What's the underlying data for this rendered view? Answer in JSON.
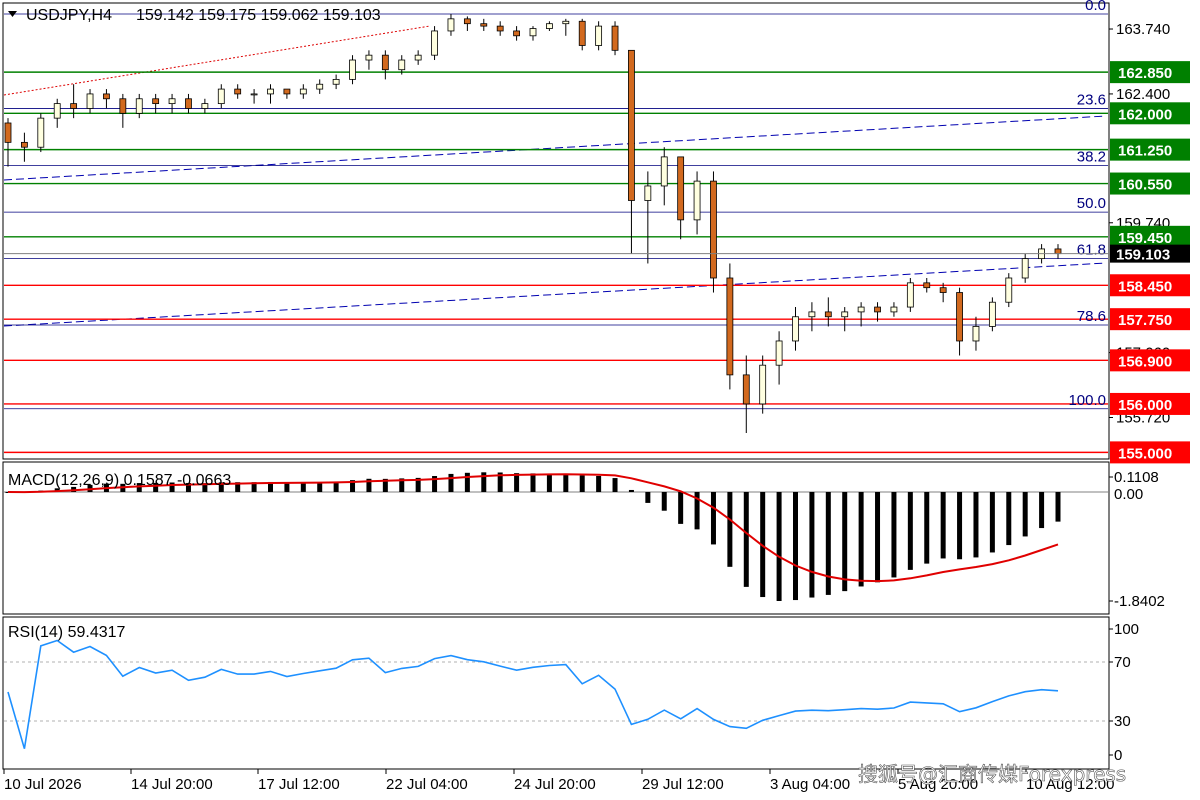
{
  "header": {
    "symbol": "USDJPY,H4",
    "ohlc": "159.142 159.175 159.062 159.103"
  },
  "price_axis": [
    {
      "text": "163.740",
      "v": 163.74
    },
    {
      "text": "162.400",
      "v": 162.4
    },
    {
      "text": "159.740",
      "v": 159.74
    },
    {
      "text": "157.060",
      "v": 157.06
    },
    {
      "text": "155.720",
      "v": 155.72
    }
  ],
  "current_price": {
    "text": "159.103",
    "v": 159.103
  },
  "levels": [
    {
      "text": "162.850",
      "v": 162.85,
      "color": "#008000"
    },
    {
      "text": "162.000",
      "v": 162.0,
      "color": "#008000"
    },
    {
      "text": "161.250",
      "v": 161.25,
      "color": "#008000"
    },
    {
      "text": "160.550",
      "v": 160.55,
      "color": "#008000"
    },
    {
      "text": "159.450",
      "v": 159.45,
      "color": "#008000"
    },
    {
      "text": "158.450",
      "v": 158.45,
      "color": "#ff0000"
    },
    {
      "text": "157.750",
      "v": 157.75,
      "color": "#ff0000"
    },
    {
      "text": "156.900",
      "v": 156.9,
      "color": "#ff0000"
    },
    {
      "text": "156.000",
      "v": 156.0,
      "color": "#ff0000"
    },
    {
      "text": "155.000",
      "v": 155.0,
      "color": "#ff0000"
    }
  ],
  "fib_levels": [
    {
      "text": "0.0",
      "v": 164.05
    },
    {
      "text": "23.6",
      "v": 162.1
    },
    {
      "text": "38.2",
      "v": 160.92
    },
    {
      "text": "50.0",
      "v": 159.96
    },
    {
      "text": "61.8",
      "v": 159.0
    },
    {
      "text": "78.6",
      "v": 157.63
    },
    {
      "text": "100.0",
      "v": 155.9
    }
  ],
  "macd": {
    "label": "MACD(12,26,9) 0.1587 -0.0663",
    "max_text": "0.1108",
    "zero_text": "0.00",
    "min_text": "-1.8402",
    "max": 0.1108,
    "min": -1.8402
  },
  "rsi": {
    "label": "RSI(14) 59.4317",
    "ticks": [
      "100",
      "70",
      "30",
      "0"
    ]
  },
  "time_axis": [
    "10 Jul 2026",
    "14 Jul 20:00",
    "17 Jul 12:00",
    "22 Jul 04:00",
    "24 Jul 20:00",
    "29 Jul 12:00",
    "3 Aug 04:00",
    "5 Aug 20:00",
    "10 Aug 12:00"
  ],
  "watermark": "搜狐号@汇商传媒Forexpress",
  "colors": {
    "bull": "#ffffe0",
    "bear": "#d2691e",
    "level_green": "#008000",
    "level_red": "#ff0000",
    "fib": "#00007f",
    "rsi": "#1e90ff",
    "signal": "#e00000"
  },
  "chart_data": {
    "type": "candlestick",
    "title": "USDJPY,H4",
    "timeframe": "H4",
    "ylim": [
      155.0,
      164.2
    ],
    "candles_note_first_to_last": [
      [
        161.8,
        161.9,
        160.9,
        161.4
      ],
      [
        161.4,
        161.6,
        161.0,
        161.3
      ],
      [
        161.3,
        162.0,
        161.2,
        161.9
      ],
      [
        161.9,
        162.3,
        161.7,
        162.2
      ],
      [
        162.2,
        162.6,
        161.9,
        162.1
      ],
      [
        162.1,
        162.5,
        162.0,
        162.4
      ],
      [
        162.4,
        162.5,
        162.1,
        162.3
      ],
      [
        162.3,
        162.4,
        161.7,
        162.0
      ],
      [
        162.0,
        162.4,
        161.9,
        162.3
      ],
      [
        162.3,
        162.4,
        162.0,
        162.2
      ],
      [
        162.2,
        162.4,
        162.0,
        162.3
      ],
      [
        162.3,
        162.4,
        162.0,
        162.1
      ],
      [
        162.1,
        162.3,
        162.0,
        162.2
      ],
      [
        162.2,
        162.6,
        162.1,
        162.5
      ],
      [
        162.5,
        162.6,
        162.3,
        162.4
      ],
      [
        162.4,
        162.5,
        162.2,
        162.4
      ],
      [
        162.4,
        162.6,
        162.2,
        162.5
      ],
      [
        162.5,
        162.5,
        162.3,
        162.4
      ],
      [
        162.4,
        162.6,
        162.3,
        162.5
      ],
      [
        162.5,
        162.7,
        162.4,
        162.6
      ],
      [
        162.6,
        162.8,
        162.5,
        162.7
      ],
      [
        162.7,
        163.2,
        162.6,
        163.1
      ],
      [
        163.1,
        163.3,
        162.9,
        163.2
      ],
      [
        163.2,
        163.3,
        162.7,
        162.9
      ],
      [
        162.9,
        163.2,
        162.8,
        163.1
      ],
      [
        163.1,
        163.3,
        163.0,
        163.2
      ],
      [
        163.2,
        163.8,
        163.1,
        163.7
      ],
      [
        163.7,
        164.05,
        163.6,
        163.95
      ],
      [
        163.95,
        164.0,
        163.7,
        163.85
      ],
      [
        163.85,
        163.95,
        163.7,
        163.8
      ],
      [
        163.8,
        163.9,
        163.6,
        163.7
      ],
      [
        163.7,
        163.8,
        163.5,
        163.6
      ],
      [
        163.6,
        163.8,
        163.5,
        163.75
      ],
      [
        163.75,
        163.9,
        163.7,
        163.85
      ],
      [
        163.85,
        163.95,
        163.6,
        163.9
      ],
      [
        163.9,
        163.95,
        163.3,
        163.4
      ],
      [
        163.4,
        163.9,
        163.3,
        163.8
      ],
      [
        163.8,
        163.9,
        163.2,
        163.3
      ],
      [
        163.3,
        162.6,
        159.1,
        160.2
      ],
      [
        160.2,
        160.8,
        158.9,
        160.5
      ],
      [
        160.5,
        161.3,
        160.1,
        161.1
      ],
      [
        161.1,
        160.9,
        159.4,
        159.8
      ],
      [
        159.8,
        160.8,
        159.5,
        160.6
      ],
      [
        160.6,
        160.8,
        158.3,
        158.6
      ],
      [
        158.6,
        158.9,
        156.3,
        156.6
      ],
      [
        156.6,
        157.0,
        155.4,
        156.0
      ],
      [
        156.0,
        157.0,
        155.8,
        156.8
      ],
      [
        156.8,
        157.5,
        156.4,
        157.3
      ],
      [
        157.3,
        158.0,
        157.1,
        157.8
      ],
      [
        157.8,
        158.1,
        157.5,
        157.9
      ],
      [
        157.9,
        158.2,
        157.6,
        157.8
      ],
      [
        157.8,
        158.0,
        157.5,
        157.9
      ],
      [
        157.9,
        158.1,
        157.6,
        158.0
      ],
      [
        158.0,
        158.1,
        157.7,
        157.9
      ],
      [
        157.9,
        158.1,
        157.8,
        158.0
      ],
      [
        158.0,
        158.6,
        157.9,
        158.5
      ],
      [
        158.5,
        158.6,
        158.3,
        158.4
      ],
      [
        158.4,
        158.5,
        158.1,
        158.3
      ],
      [
        158.3,
        158.4,
        157.0,
        157.3
      ],
      [
        157.3,
        157.8,
        157.1,
        157.6
      ],
      [
        157.6,
        158.2,
        157.5,
        158.1
      ],
      [
        158.1,
        158.7,
        158.0,
        158.6
      ],
      [
        158.6,
        159.1,
        158.5,
        159.0
      ],
      [
        159.0,
        159.3,
        158.9,
        159.2
      ],
      [
        159.2,
        159.3,
        159.0,
        159.103
      ]
    ]
  }
}
